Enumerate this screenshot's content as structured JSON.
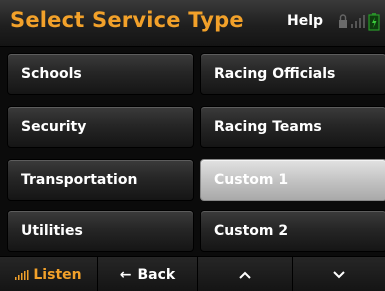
{
  "header": {
    "title": "Select Service Type",
    "help_label": "Help",
    "status_icons": [
      "lock-icon",
      "signal-bars-icon",
      "battery-icon"
    ]
  },
  "buttons": [
    {
      "label": "Schools",
      "selected": false
    },
    {
      "label": "Racing Officials",
      "selected": false
    },
    {
      "label": "Security",
      "selected": false
    },
    {
      "label": "Racing Teams",
      "selected": false
    },
    {
      "label": "Transportation",
      "selected": false
    },
    {
      "label": "Custom 1",
      "selected": true
    },
    {
      "label": "Utilities",
      "selected": false
    },
    {
      "label": "Custom 2",
      "selected": false
    }
  ],
  "bottom_bar": {
    "listen_label": "Listen",
    "back_label": "Back",
    "back_glyph": "←",
    "up_glyph": "^",
    "down_glyph": "⌄"
  },
  "colors": {
    "accent": "#f2a12a",
    "selected_button": "#c4c4c4",
    "background": "#0b0b0b"
  }
}
